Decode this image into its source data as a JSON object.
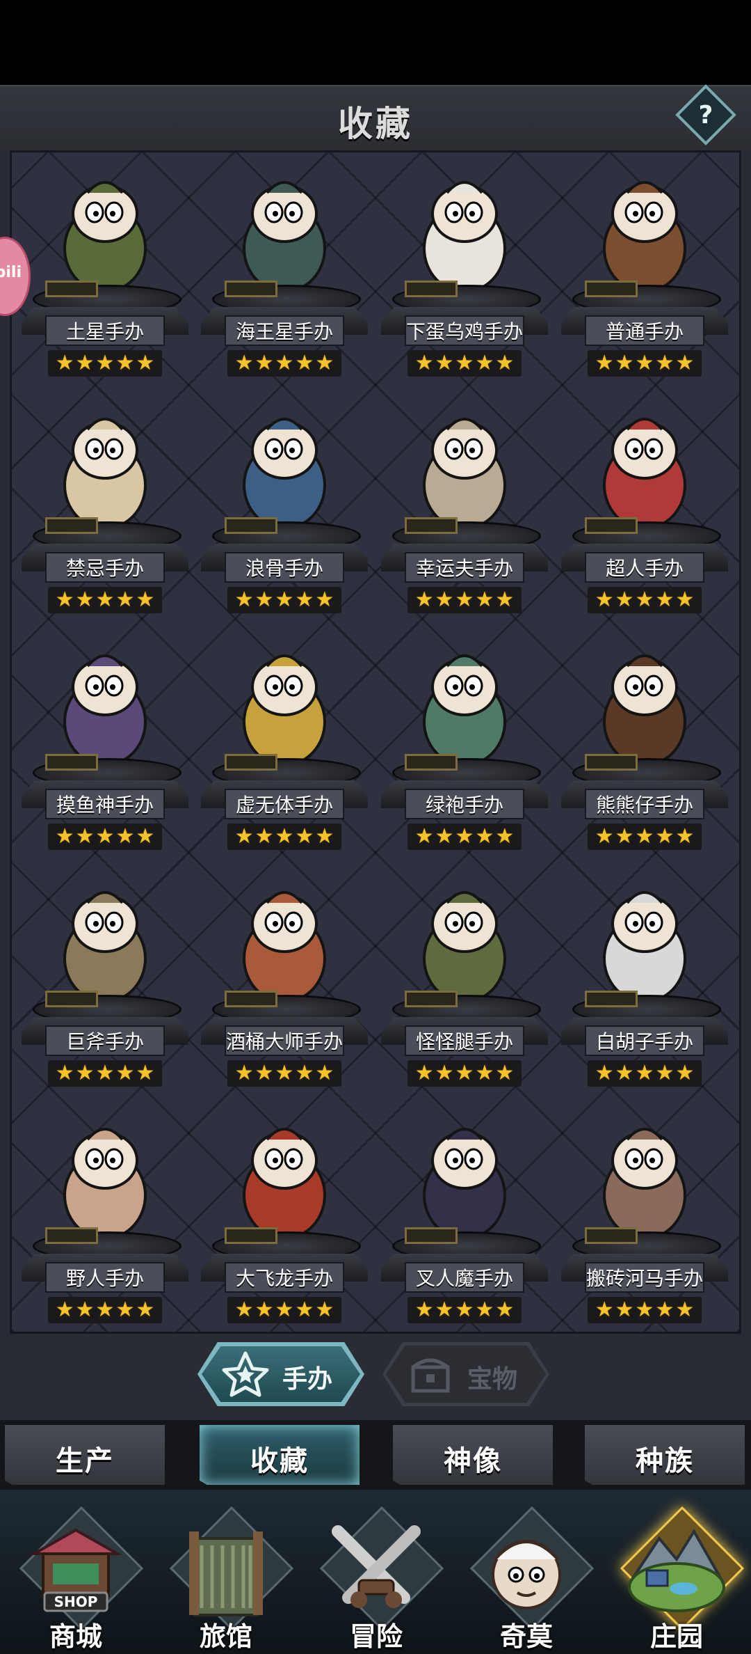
{
  "header": {
    "title": "收藏",
    "help_label": "?"
  },
  "side_bubble": {
    "text": "bili"
  },
  "figures": [
    {
      "name": "土星手办",
      "stars": 5,
      "icon": "frog-figure-icon"
    },
    {
      "name": "海王星手办",
      "stars": 5,
      "icon": "neptune-figure-icon"
    },
    {
      "name": "下蛋乌鸡手办",
      "stars": 5,
      "icon": "chicken-figure-icon"
    },
    {
      "name": "普通手办",
      "stars": 5,
      "icon": "pumpkin-figure-icon"
    },
    {
      "name": "禁忌手办",
      "stars": 5,
      "icon": "forbidden-figure-icon"
    },
    {
      "name": "浪骨手办",
      "stars": 5,
      "icon": "skeleton-figure-icon"
    },
    {
      "name": "幸运夫手办",
      "stars": 5,
      "icon": "wizard-figure-icon"
    },
    {
      "name": "超人手办",
      "stars": 5,
      "icon": "hero-figure-icon"
    },
    {
      "name": "摸鱼神手办",
      "stars": 5,
      "icon": "reaper-figure-icon"
    },
    {
      "name": "虚无体手办",
      "stars": 5,
      "icon": "void-figure-icon"
    },
    {
      "name": "绿袍手办",
      "stars": 5,
      "icon": "green-robe-figure-icon"
    },
    {
      "name": "熊熊仔手办",
      "stars": 5,
      "icon": "bear-figure-icon"
    },
    {
      "name": "巨斧手办",
      "stars": 5,
      "icon": "axe-figure-icon"
    },
    {
      "name": "酒桶大师手办",
      "stars": 5,
      "icon": "barrel-figure-icon"
    },
    {
      "name": "怪怪腿手办",
      "stars": 5,
      "icon": "boxer-figure-icon"
    },
    {
      "name": "白胡子手办",
      "stars": 5,
      "icon": "beard-figure-icon"
    },
    {
      "name": "野人手办",
      "stars": 5,
      "icon": "savage-figure-icon"
    },
    {
      "name": "大飞龙手办",
      "stars": 5,
      "icon": "dragon-figure-icon"
    },
    {
      "name": "叉人魔手办",
      "stars": 5,
      "icon": "imp-figure-icon"
    },
    {
      "name": "搬砖河马手办",
      "stars": 5,
      "icon": "hippo-figure-icon"
    }
  ],
  "toggles": [
    {
      "label": "手办",
      "active": true,
      "icon": "star-pedestal-icon"
    },
    {
      "label": "宝物",
      "active": false,
      "icon": "treasure-icon"
    }
  ],
  "tabs": [
    {
      "label": "生产",
      "active": false
    },
    {
      "label": "收藏",
      "active": true
    },
    {
      "label": "神像",
      "active": false
    },
    {
      "label": "种族",
      "active": false
    }
  ],
  "nav": [
    {
      "label": "商城",
      "sign": "SHOP",
      "icon": "shop-icon",
      "active": false
    },
    {
      "label": "旅馆",
      "icon": "gate-icon",
      "active": false
    },
    {
      "label": "冒险",
      "icon": "crossed-swords-icon",
      "active": false
    },
    {
      "label": "奇莫",
      "icon": "kimo-icon",
      "active": false
    },
    {
      "label": "庄园",
      "icon": "island-icon",
      "active": true
    }
  ],
  "colors": {
    "star": "#f5c22c",
    "accent": "#7fb7c0",
    "panel": "#2a2c33"
  }
}
